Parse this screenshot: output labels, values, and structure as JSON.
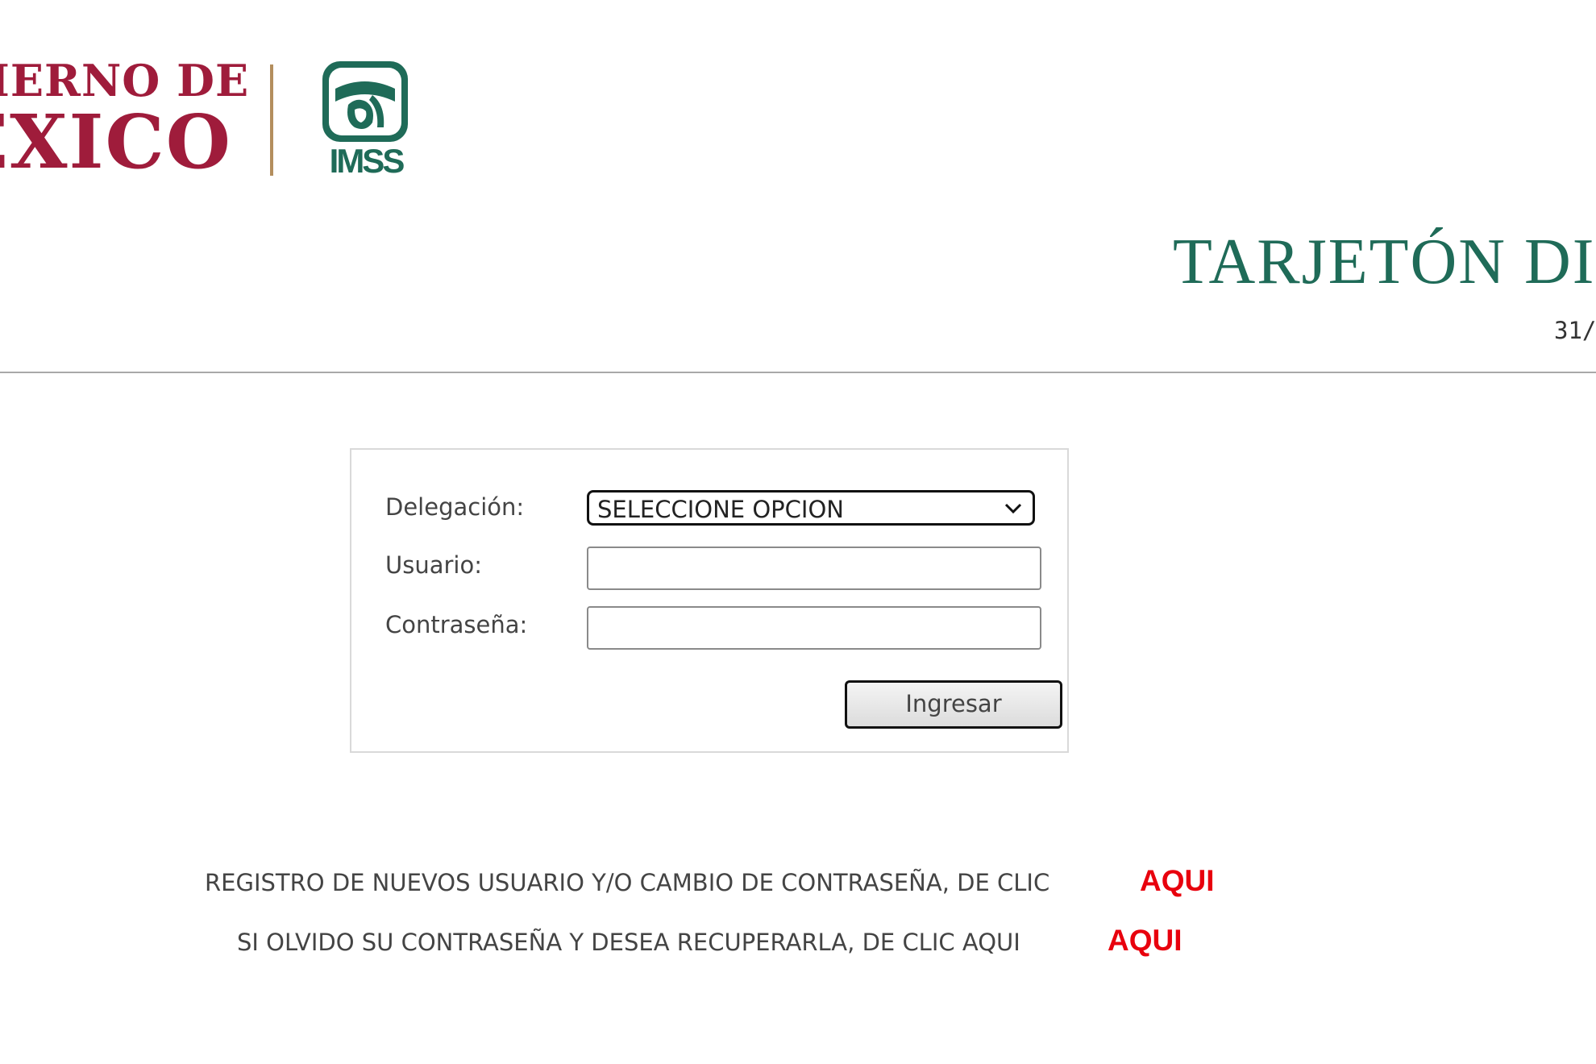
{
  "header": {
    "gob_line1": "BIERNO DE",
    "gob_line2": "ÉXICO",
    "imss_text": "IMSS",
    "title": "TARJETÓN DIG",
    "date": "31/"
  },
  "login": {
    "delegacion_label": "Delegación:",
    "delegacion_value": "SELECCIONE OPCION",
    "usuario_label": "Usuario:",
    "usuario_value": "",
    "contrasena_label": "Contraseña:",
    "contrasena_value": "",
    "submit_label": "Ingresar"
  },
  "footer": {
    "register_text": "REGISTRO DE NUEVOS USUARIO Y/O CAMBIO DE CONTRASEÑA, DE CLIC",
    "register_link": "AQUI",
    "recover_text": "SI OLVIDO SU CONTRASEÑA Y DESEA RECUPERARLA, DE CLIC AQUI",
    "recover_link": "AQUI"
  },
  "colors": {
    "gob_red": "#9f1c3b",
    "imss_green": "#1f6b58",
    "divider_gold": "#b38e5d",
    "link_red": "#e8000d"
  },
  "icons": {
    "select_arrow": "chevron-down-icon",
    "imss_emblem": "imss-eagle-icon"
  }
}
